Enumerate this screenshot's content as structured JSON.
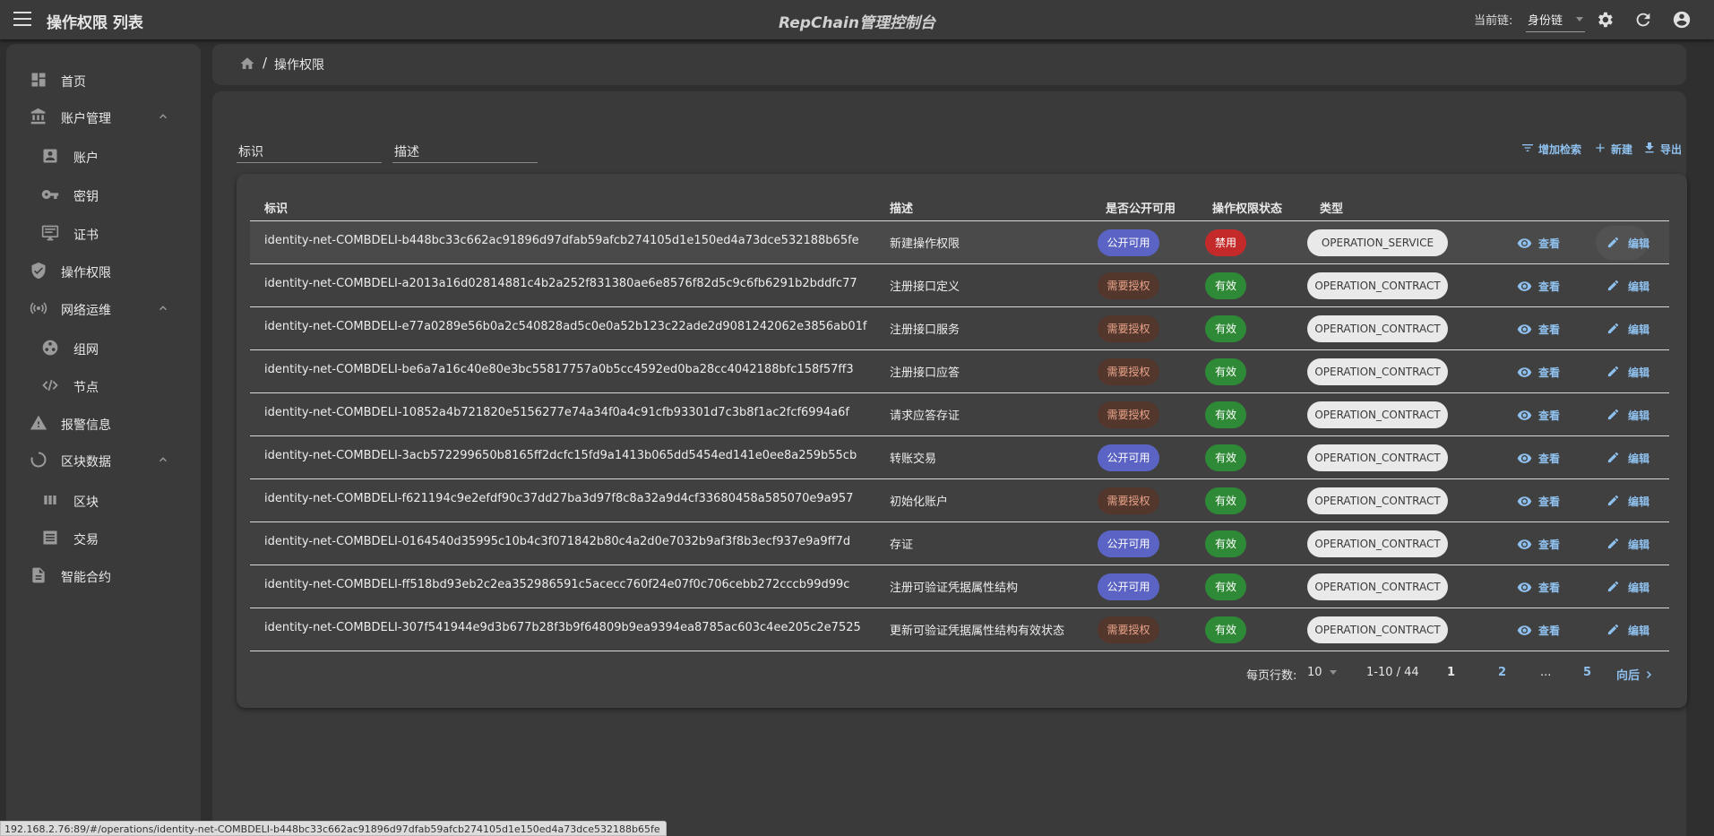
{
  "app": {
    "title": "操作权限 列表",
    "center_title": "RepChain管理控制台",
    "chain_label": "当前链:",
    "chain_value": "身份链"
  },
  "sidebar": {
    "items": [
      {
        "label": "首页"
      },
      {
        "label": "账户管理"
      },
      {
        "label": "账户"
      },
      {
        "label": "密钥"
      },
      {
        "label": "证书"
      },
      {
        "label": "操作权限"
      },
      {
        "label": "网络运维"
      },
      {
        "label": "组网"
      },
      {
        "label": "节点"
      },
      {
        "label": "报警信息"
      },
      {
        "label": "区块数据"
      },
      {
        "label": "区块"
      },
      {
        "label": "交易"
      },
      {
        "label": "智能合约"
      }
    ]
  },
  "breadcrumb": {
    "separator": "/",
    "current": "操作权限"
  },
  "filters": {
    "id_label": "标识",
    "desc_label": "描述"
  },
  "actions": {
    "add_filter": "增加检索",
    "create": "新建",
    "export": "导出"
  },
  "table": {
    "headers": {
      "id": "标识",
      "desc": "描述",
      "public": "是否公开可用",
      "status": "操作权限状态",
      "type": "类型"
    },
    "rows": [
      {
        "id": "identity-net-COMBDELI-b448bc33c662ac91896d97dfab59afcb274105d1e150ed4a73dce532188b65fe",
        "desc": "新建操作权限",
        "public": "公开可用",
        "public_kind": "public",
        "status": "禁用",
        "status_kind": "off",
        "type": "OPERATION_SERVICE",
        "view": "查看",
        "edit": "编辑"
      },
      {
        "id": "identity-net-COMBDELI-a2013a16d02814881c4b2a252f831380ae6e8576f82d5c9c6fb6291b2bddfc77",
        "desc": "注册接口定义",
        "public": "需要授权",
        "public_kind": "auth",
        "status": "有效",
        "status_kind": "ok",
        "type": "OPERATION_CONTRACT",
        "view": "查看",
        "edit": "编辑"
      },
      {
        "id": "identity-net-COMBDELI-e77a0289e56b0a2c540828ad5c0e0a52b123c22ade2d9081242062e3856ab01f",
        "desc": "注册接口服务",
        "public": "需要授权",
        "public_kind": "auth",
        "status": "有效",
        "status_kind": "ok",
        "type": "OPERATION_CONTRACT",
        "view": "查看",
        "edit": "编辑"
      },
      {
        "id": "identity-net-COMBDELI-be6a7a16c40e80e3bc55817757a0b5cc4592ed0ba28cc4042188bfc158f57ff3",
        "desc": "注册接口应答",
        "public": "需要授权",
        "public_kind": "auth",
        "status": "有效",
        "status_kind": "ok",
        "type": "OPERATION_CONTRACT",
        "view": "查看",
        "edit": "编辑"
      },
      {
        "id": "identity-net-COMBDELI-10852a4b721820e5156277e74a34f0a4c91cfb93301d7c3b8f1ac2fcf6994a6f",
        "desc": "请求应答存证",
        "public": "需要授权",
        "public_kind": "auth",
        "status": "有效",
        "status_kind": "ok",
        "type": "OPERATION_CONTRACT",
        "view": "查看",
        "edit": "编辑"
      },
      {
        "id": "identity-net-COMBDELI-3acb572299650b8165ff2dcfc15fd9a1413b065dd5454ed141e0ee8a259b55cb",
        "desc": "转账交易",
        "public": "公开可用",
        "public_kind": "public",
        "status": "有效",
        "status_kind": "ok",
        "type": "OPERATION_CONTRACT",
        "view": "查看",
        "edit": "编辑"
      },
      {
        "id": "identity-net-COMBDELI-f621194c9e2efdf90c37dd27ba3d97f8c8a32a9d4cf33680458a585070e9a957",
        "desc": "初始化账户",
        "public": "需要授权",
        "public_kind": "auth",
        "status": "有效",
        "status_kind": "ok",
        "type": "OPERATION_CONTRACT",
        "view": "查看",
        "edit": "编辑"
      },
      {
        "id": "identity-net-COMBDELI-0164540d35995c10b4c3f071842b80c4a2d0e7032b9af3f8b3ecf937e9a9ff7d",
        "desc": "存证",
        "public": "公开可用",
        "public_kind": "public",
        "status": "有效",
        "status_kind": "ok",
        "type": "OPERATION_CONTRACT",
        "view": "查看",
        "edit": "编辑"
      },
      {
        "id": "identity-net-COMBDELI-ff518bd93eb2c2ea352986591c5acecc760f24e07f0c706cebb272cccb99d99c",
        "desc": "注册可验证凭据属性结构",
        "public": "公开可用",
        "public_kind": "public",
        "status": "有效",
        "status_kind": "ok",
        "type": "OPERATION_CONTRACT",
        "view": "查看",
        "edit": "编辑"
      },
      {
        "id": "identity-net-COMBDELI-307f541944e9d3b677b28f3b9f64809b9ea9394ea8785ac603c4ee205c2e7525",
        "desc": "更新可验证凭据属性结构有效状态",
        "public": "需要授权",
        "public_kind": "auth",
        "status": "有效",
        "status_kind": "ok",
        "type": "OPERATION_CONTRACT",
        "view": "查看",
        "edit": "编辑"
      }
    ]
  },
  "pagination": {
    "rows_per_page_label": "每页行数:",
    "rows_per_page": "10",
    "range": "1-10 / 44",
    "pages": [
      "1",
      "2",
      "...",
      "5"
    ],
    "next": "向后"
  },
  "status_url": "192.168.2.76:89/#/operations/identity-net-COMBDELI-b448bc33c662ac91896d97dfab59afcb274105d1e150ed4a73dce532188b65fe",
  "colors": {
    "accent": "#8fc0ee",
    "public_chip": "#5b64c4",
    "auth_chip": "#53362c",
    "ok_chip": "#2e8a36",
    "off_chip": "#c42a2a"
  },
  "icons": [
    "menu-icon",
    "settings-icon",
    "refresh-icon",
    "account-circle-icon",
    "dashboard-icon",
    "bank-icon",
    "contact-icon",
    "key-icon",
    "certificate-icon",
    "shield-icon",
    "network-icon",
    "cluster-icon",
    "code-icon",
    "warning-icon",
    "loading-icon",
    "blocks-icon",
    "list-icon",
    "document-icon",
    "home-icon",
    "filter-icon",
    "plus-icon",
    "download-icon",
    "eye-icon",
    "pencil-icon",
    "chevron-up-icon",
    "chevron-right-icon"
  ]
}
